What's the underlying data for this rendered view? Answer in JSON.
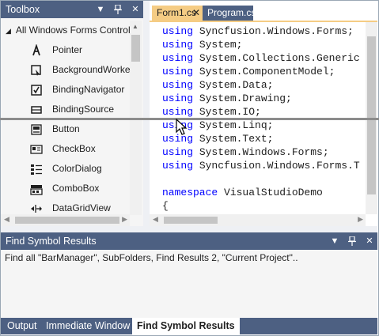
{
  "toolbox": {
    "title": "Toolbox",
    "category": "All Windows Forms Control",
    "items": [
      {
        "label": "Pointer",
        "icon": "pointer-icon"
      },
      {
        "label": "BackgroundWorker",
        "icon": "background-worker-icon"
      },
      {
        "label": "BindingNavigator",
        "icon": "binding-navigator-icon"
      },
      {
        "label": "BindingSource",
        "icon": "binding-source-icon"
      },
      {
        "label": "Button",
        "icon": "button-icon"
      },
      {
        "label": "CheckBox",
        "icon": "checkbox-icon"
      },
      {
        "label": "ColorDialog",
        "icon": "color-dialog-icon"
      },
      {
        "label": "ComboBox",
        "icon": "combobox-icon"
      },
      {
        "label": "DataGridView",
        "icon": "datagridview-icon"
      }
    ]
  },
  "editor": {
    "tabs": [
      {
        "label": "Form1.cs",
        "active": true
      },
      {
        "label": "Program.cs",
        "active": false
      }
    ],
    "lines": [
      {
        "kw": "using",
        "rest": " Syncfusion.Windows.Forms;"
      },
      {
        "kw": "using",
        "rest": " System;"
      },
      {
        "kw": "using",
        "rest": " System.Collections.Generic"
      },
      {
        "kw": "using",
        "rest": " System.ComponentModel;"
      },
      {
        "kw": "using",
        "rest": " System.Data;"
      },
      {
        "kw": "using",
        "rest": " System.Drawing;"
      },
      {
        "kw": "using",
        "rest": " System.IO;"
      },
      {
        "kw": "using",
        "rest": " System.Linq;"
      },
      {
        "kw": "using",
        "rest": " System.Text;"
      },
      {
        "kw": "using",
        "rest": " System.Windows.Forms;"
      },
      {
        "kw": "using",
        "rest": " Syncfusion.Windows.Forms.T"
      },
      {
        "kw": "",
        "rest": ""
      },
      {
        "kw": "namespace",
        "rest": " VisualStudioDemo"
      },
      {
        "kw": "",
        "rest": "{"
      }
    ]
  },
  "results": {
    "title": "Find Symbol Results",
    "text": "Find all \"BarManager\", SubFolders, Find Results 2, \"Current Project\".."
  },
  "bottom_tabs": [
    {
      "label": "Output",
      "active": false
    },
    {
      "label": "Immediate Window",
      "active": false
    },
    {
      "label": "Find Symbol Results",
      "active": true
    }
  ],
  "colors": {
    "title_bar": "#4d6082",
    "active_tab": "#f5cc84",
    "keyword": "#0000ff"
  }
}
